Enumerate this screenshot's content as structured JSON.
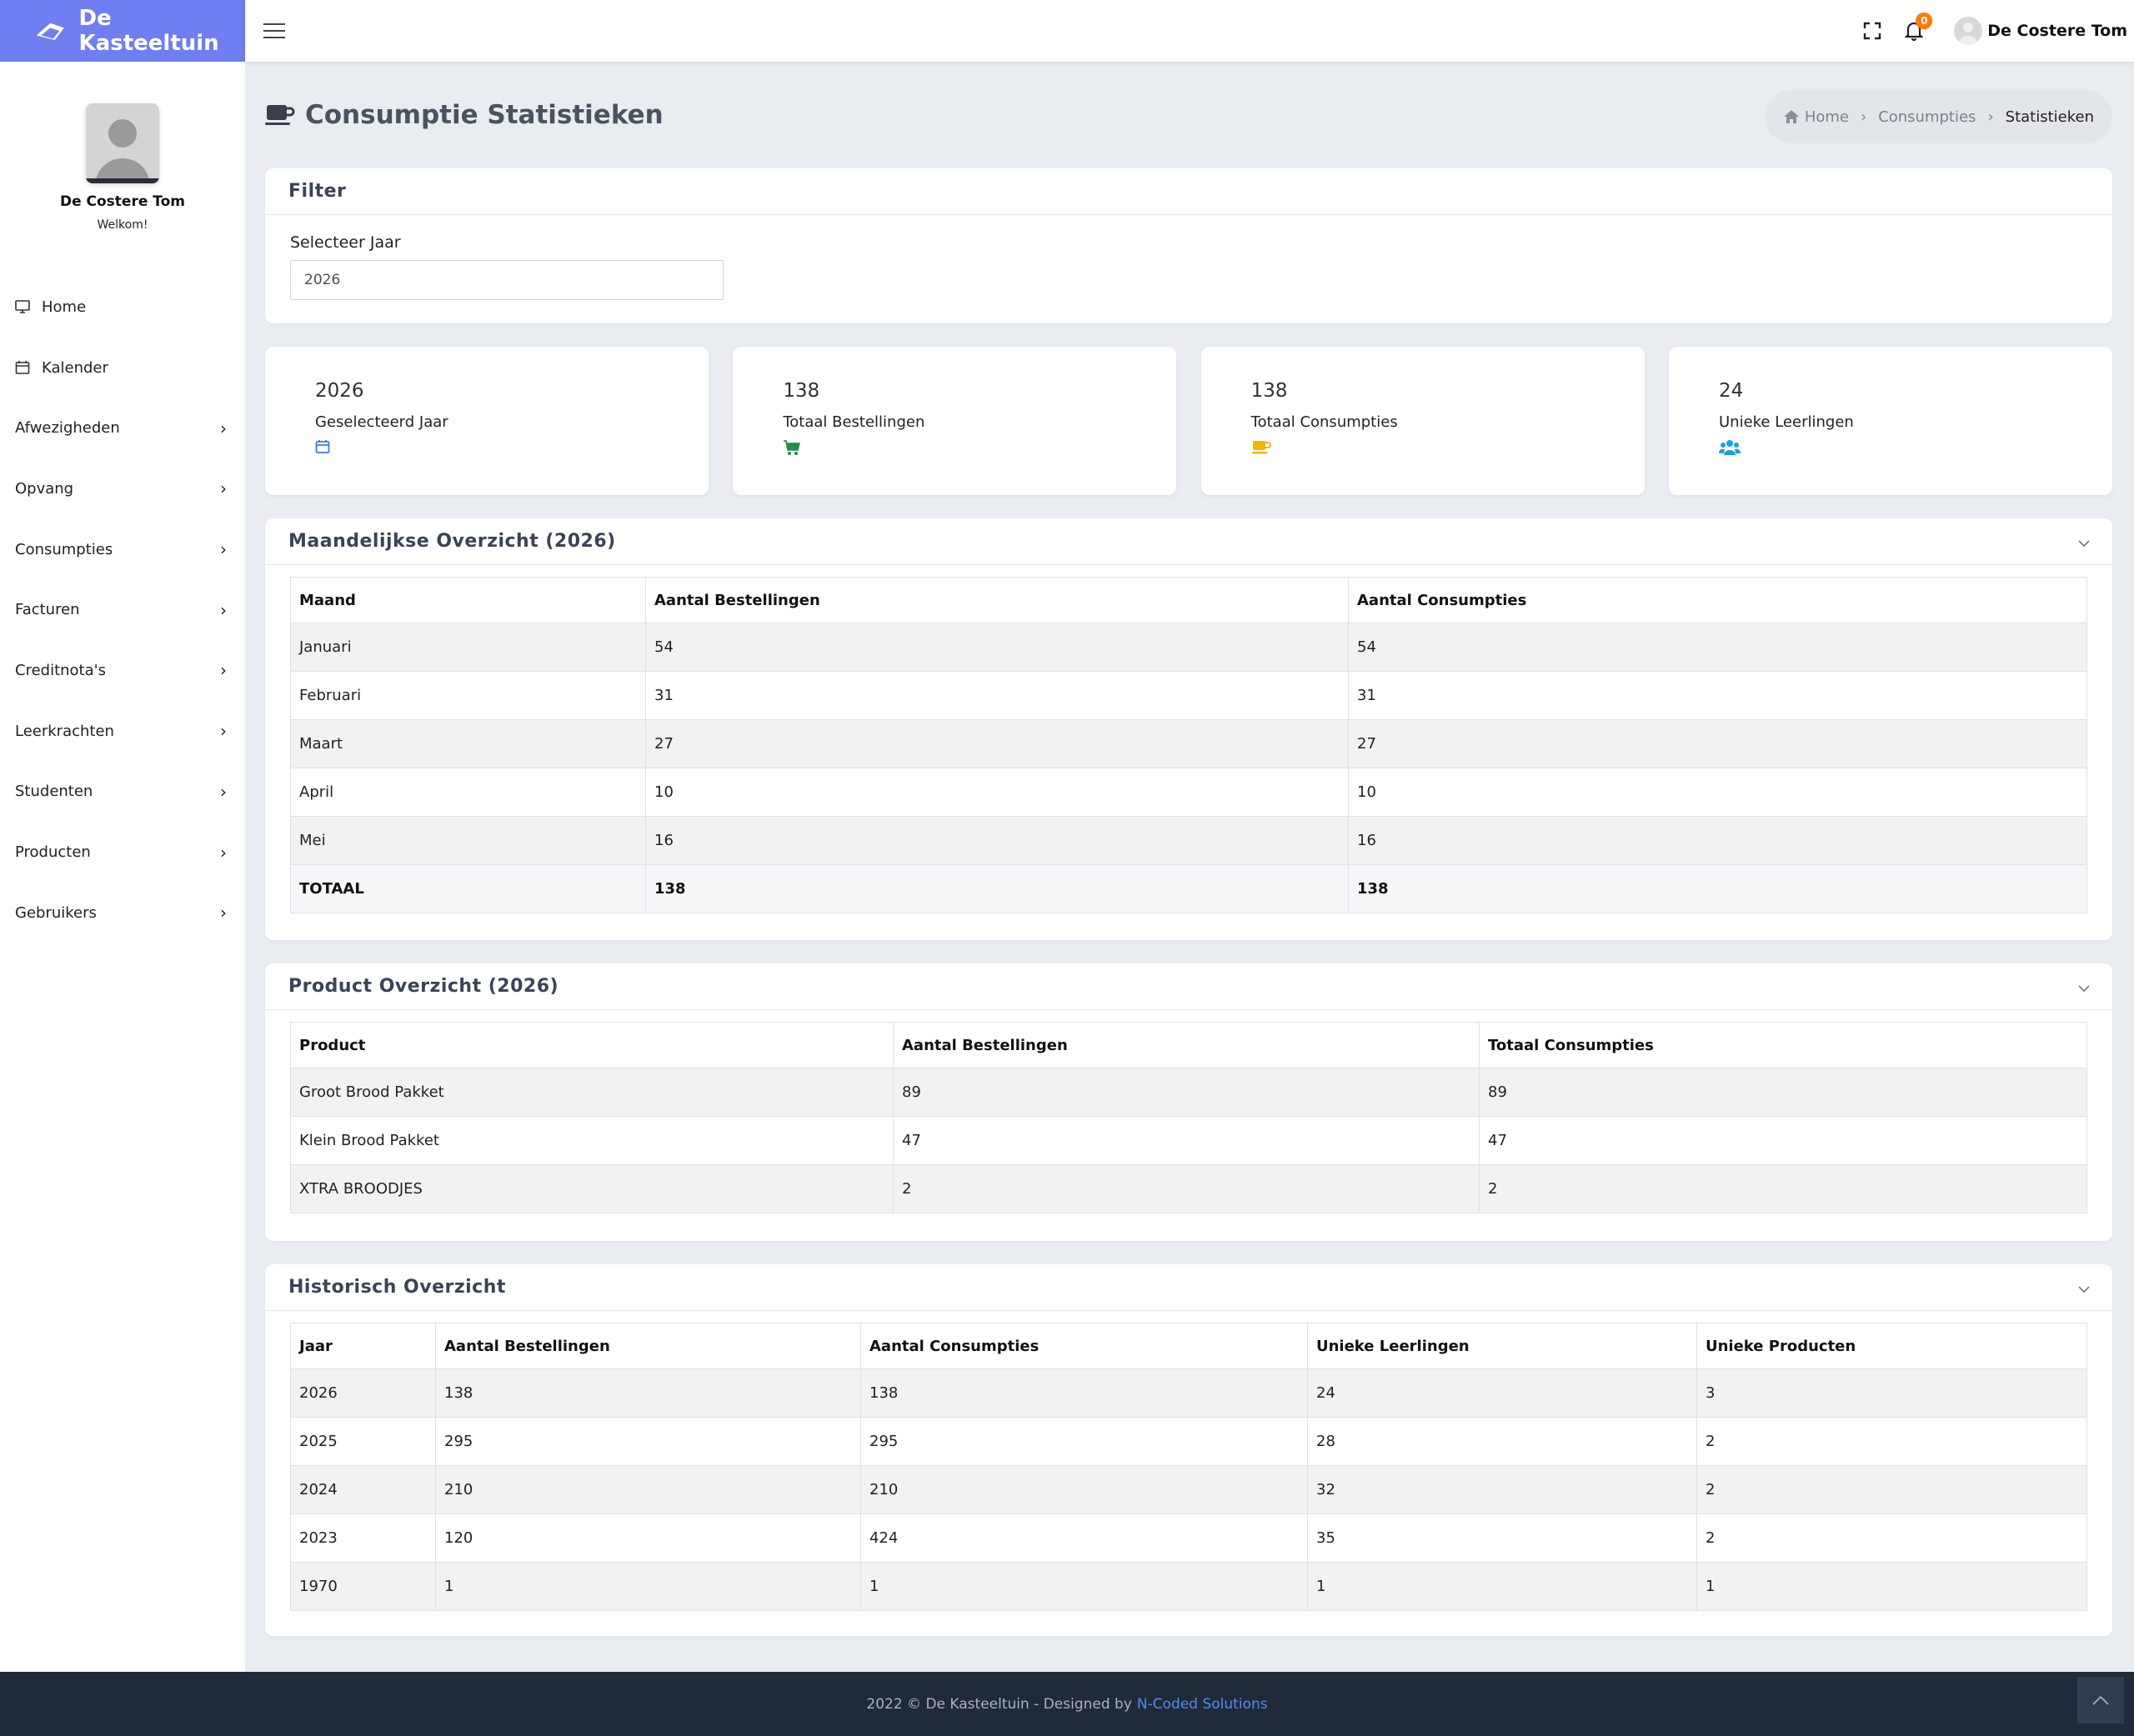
{
  "app": {
    "brand": "De Kasteeltuin"
  },
  "topbar": {
    "notification_count": "0",
    "user_name": "De Costere Tom"
  },
  "sidebar": {
    "profile_name": "De Costere Tom",
    "welcome": "Welkom!",
    "items": [
      {
        "label": "Home",
        "icon": "monitor-icon"
      },
      {
        "label": "Kalender",
        "icon": "calendar-icon"
      },
      {
        "label": "Afwezigheden"
      },
      {
        "label": "Opvang"
      },
      {
        "label": "Consumpties"
      },
      {
        "label": "Facturen"
      },
      {
        "label": "Creditnota's"
      },
      {
        "label": "Leerkrachten"
      },
      {
        "label": "Studenten"
      },
      {
        "label": "Producten"
      },
      {
        "label": "Gebruikers"
      }
    ]
  },
  "page": {
    "title": "Consumptie Statistieken"
  },
  "breadcrumb": {
    "home": "Home",
    "section": "Consumpties",
    "current": "Statistieken"
  },
  "filter": {
    "title": "Filter",
    "label": "Selecteer Jaar",
    "value": "2026"
  },
  "stats": [
    {
      "value": "2026",
      "label": "Geselecteerd Jaar",
      "icon": "calendar-icon",
      "color": "#3b7ddd"
    },
    {
      "value": "138",
      "label": "Totaal Bestellingen",
      "icon": "cart-icon",
      "color": "#1e8e4a"
    },
    {
      "value": "138",
      "label": "Totaal Consumpties",
      "icon": "coffee-icon",
      "color": "#f5b400"
    },
    {
      "value": "24",
      "label": "Unieke Leerlingen",
      "icon": "users-icon",
      "color": "#17a2d8"
    }
  ],
  "monthly": {
    "title": "Maandelijkse Overzicht (2026)",
    "headers": [
      "Maand",
      "Aantal Bestellingen",
      "Aantal Consumpties"
    ],
    "rows": [
      [
        "Januari",
        "54",
        "54"
      ],
      [
        "Februari",
        "31",
        "31"
      ],
      [
        "Maart",
        "27",
        "27"
      ],
      [
        "April",
        "10",
        "10"
      ],
      [
        "Mei",
        "16",
        "16"
      ]
    ],
    "total": [
      "TOTAAL",
      "138",
      "138"
    ]
  },
  "products": {
    "title": "Product Overzicht (2026)",
    "headers": [
      "Product",
      "Aantal Bestellingen",
      "Totaal Consumpties"
    ],
    "rows": [
      [
        "Groot Brood Pakket",
        "89",
        "89"
      ],
      [
        "Klein Brood Pakket",
        "47",
        "47"
      ],
      [
        "XTRA BROODJES",
        "2",
        "2"
      ]
    ]
  },
  "history": {
    "title": "Historisch Overzicht",
    "headers": [
      "Jaar",
      "Aantal Bestellingen",
      "Aantal Consumpties",
      "Unieke Leerlingen",
      "Unieke Producten"
    ],
    "rows": [
      [
        "2026",
        "138",
        "138",
        "24",
        "3"
      ],
      [
        "2025",
        "295",
        "295",
        "28",
        "2"
      ],
      [
        "2024",
        "210",
        "210",
        "32",
        "2"
      ],
      [
        "2023",
        "120",
        "424",
        "35",
        "2"
      ],
      [
        "1970",
        "1",
        "1",
        "1",
        "1"
      ]
    ]
  },
  "footer": {
    "text": "2022 © De Kasteeltuin - Designed by",
    "link": "N-Coded Solutions"
  }
}
